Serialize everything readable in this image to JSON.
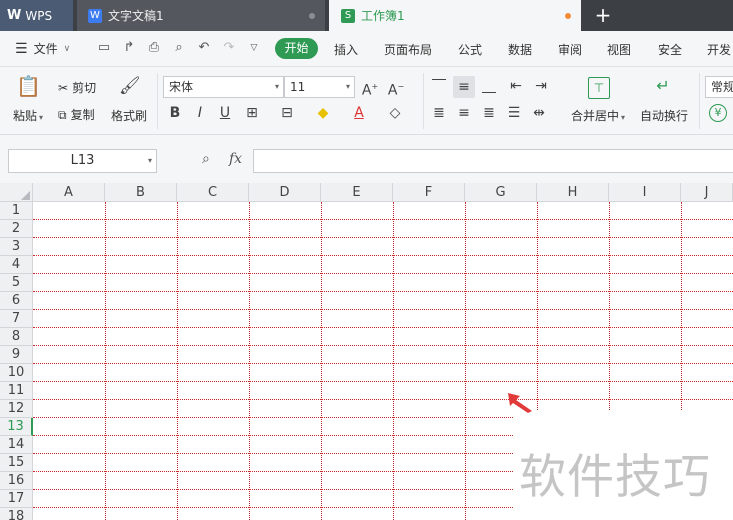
{
  "tabs": {
    "wps": "WPS",
    "doc": "文字文稿1",
    "book": "工作簿1",
    "new_tab": "+"
  },
  "menu": {
    "file": "文件",
    "items": [
      "开始",
      "插入",
      "页面布局",
      "公式",
      "数据",
      "审阅",
      "视图",
      "安全",
      "开发"
    ]
  },
  "ribbon": {
    "paste": "粘贴",
    "cut": "剪切",
    "copy": "复制",
    "format_painter": "格式刷",
    "font_name": "宋体",
    "font_size": "11",
    "merge_center": "合并居中",
    "wrap_text": "自动换行",
    "number_format": "常规"
  },
  "formula_bar": {
    "name_box": "L13",
    "fx": "fx",
    "formula": ""
  },
  "columns": [
    "A",
    "B",
    "C",
    "D",
    "E",
    "F",
    "G",
    "H",
    "I",
    "J"
  ],
  "rows": [
    "1",
    "2",
    "3",
    "4",
    "5",
    "6",
    "7",
    "8",
    "9",
    "10",
    "11",
    "12",
    "13",
    "14",
    "15",
    "16",
    "17",
    "18"
  ],
  "active_row": "13",
  "watermark": "软件技巧",
  "colors": {
    "accent": "#2e9a53",
    "gridline": "#cc2a2a",
    "cursor": "#e03a3a"
  }
}
